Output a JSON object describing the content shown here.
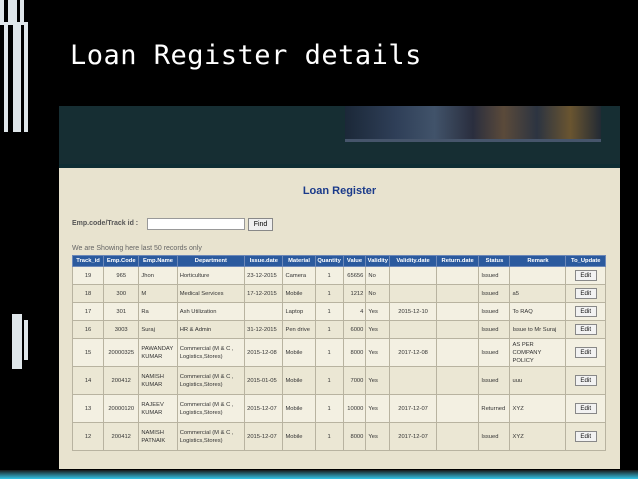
{
  "slide": {
    "title": "Loan Register details"
  },
  "app": {
    "heading": "Loan Register",
    "search": {
      "label": "Emp.code/Track id :",
      "value": "",
      "find_label": "Find"
    },
    "notice": "We are Showing here last 50 records only",
    "columns": [
      "Track_id",
      "Emp.Code",
      "Emp.Name",
      "Department",
      "Issue.date",
      "Material",
      "Quantity",
      "Value",
      "Validity",
      "Validity.date",
      "Return.date",
      "Status",
      "Remark",
      "To_Update"
    ],
    "rows": [
      {
        "track_id": "19",
        "emp_code": "965",
        "emp_name": "Jhon",
        "department": "Horticulture",
        "issue_date": "23-12-2015",
        "material": "Camera",
        "quantity": "1",
        "value": "65656",
        "validity": "No",
        "validity_date": "",
        "return_date": "",
        "status": "Issued",
        "remark": "",
        "action": "Edit"
      },
      {
        "track_id": "18",
        "emp_code": "300",
        "emp_name": "M",
        "department": "Medical Services",
        "issue_date": "17-12-2015",
        "material": "Mobile",
        "quantity": "1",
        "value": "1212",
        "validity": "No",
        "validity_date": "",
        "return_date": "",
        "status": "Issued",
        "remark": "a5",
        "action": "Edit"
      },
      {
        "track_id": "17",
        "emp_code": "301",
        "emp_name": "Ra",
        "department": "Ash Utilization",
        "issue_date": "",
        "material": "Laptop",
        "quantity": "1",
        "value": "4",
        "validity": "Yes",
        "validity_date": "2015-12-10",
        "return_date": "",
        "status": "Issued",
        "remark": "To RAQ",
        "action": "Edit"
      },
      {
        "track_id": "16",
        "emp_code": "3003",
        "emp_name": "Suraj",
        "department": "HR & Admin",
        "issue_date": "31-12-2015",
        "material": "Pen drive",
        "quantity": "1",
        "value": "6000",
        "validity": "Yes",
        "validity_date": "",
        "return_date": "",
        "status": "Issued",
        "remark": "Issue to Mr Suraj",
        "action": "Edit"
      },
      {
        "track_id": "15",
        "emp_code": "20000325",
        "emp_name": "PAWANDAY KUMAR",
        "department": "Commercial (M & C , Logistics,Stores)",
        "issue_date": "2015-12-08",
        "material": "Mobile",
        "quantity": "1",
        "value": "8000",
        "validity": "Yes",
        "validity_date": "2017-12-08",
        "return_date": "",
        "status": "Issued",
        "remark": "AS PER COMPANY POLICY",
        "action": "Edit"
      },
      {
        "track_id": "14",
        "emp_code": "200412",
        "emp_name": "NAMISH KUMAR",
        "department": "Commercial (M & C , Logistics,Stores)",
        "issue_date": "2015-01-05",
        "material": "Mobile",
        "quantity": "1",
        "value": "7000",
        "validity": "Yes",
        "validity_date": "",
        "return_date": "",
        "status": "Issued",
        "remark": "uuu",
        "action": "Edit"
      },
      {
        "track_id": "13",
        "emp_code": "20000120",
        "emp_name": "RAJEEV KUMAR",
        "department": "Commercial (M & C , Logistics,Stores)",
        "issue_date": "2015-12-07",
        "material": "Mobile",
        "quantity": "1",
        "value": "10000",
        "validity": "Yes",
        "validity_date": "2017-12-07",
        "return_date": "",
        "status": "Returned",
        "remark": "XYZ",
        "action": "Edit"
      },
      {
        "track_id": "12",
        "emp_code": "200412",
        "emp_name": "NAMISH PATNAIK",
        "department": "Commercial (M & C , Logistics,Stores)",
        "issue_date": "2015-12-07",
        "material": "Mobile",
        "quantity": "1",
        "value": "8000",
        "validity": "Yes",
        "validity_date": "2017-12-07",
        "return_date": "",
        "status": "Issued",
        "remark": "XYZ",
        "action": "Edit"
      }
    ]
  },
  "colors": {
    "header_blue": "#2b5a9e",
    "heading_blue": "#1a3a8a",
    "panel_bg": "#e8e3cf",
    "accent_cyan": "#35c6e8"
  }
}
